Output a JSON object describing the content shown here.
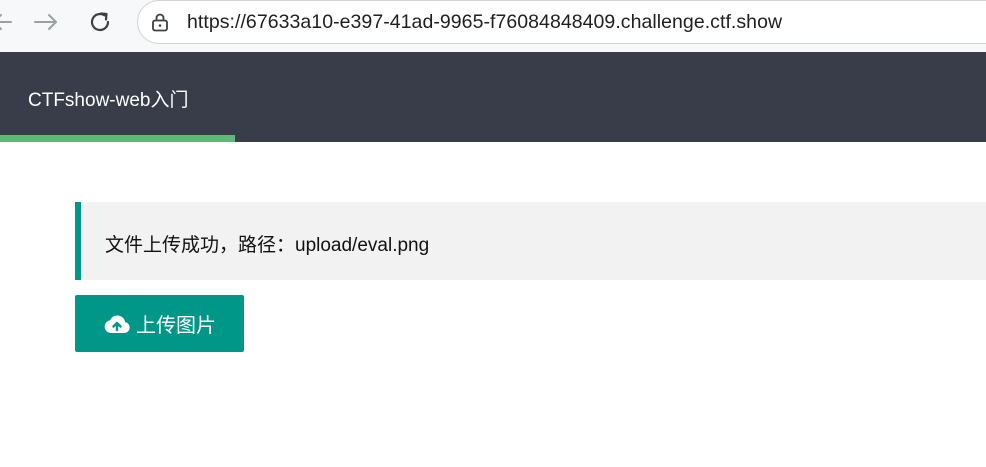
{
  "browser": {
    "url": "https://67633a10-e397-41ad-9965-f76084848409.challenge.ctf.show",
    "back_icon": "arrow-left-icon",
    "forward_icon": "arrow-right-icon",
    "reload_icon": "reload-icon",
    "lock_icon": "lock-icon"
  },
  "header": {
    "title": "CTFshow-web入门",
    "background_color": "#393d49",
    "indicator_color": "#5fb878"
  },
  "alert": {
    "message": "文件上传成功，路径：upload/eval.png",
    "accent_color": "#009688"
  },
  "upload": {
    "label": "上传图片",
    "icon": "cloud-upload-icon",
    "color": "#009688"
  }
}
